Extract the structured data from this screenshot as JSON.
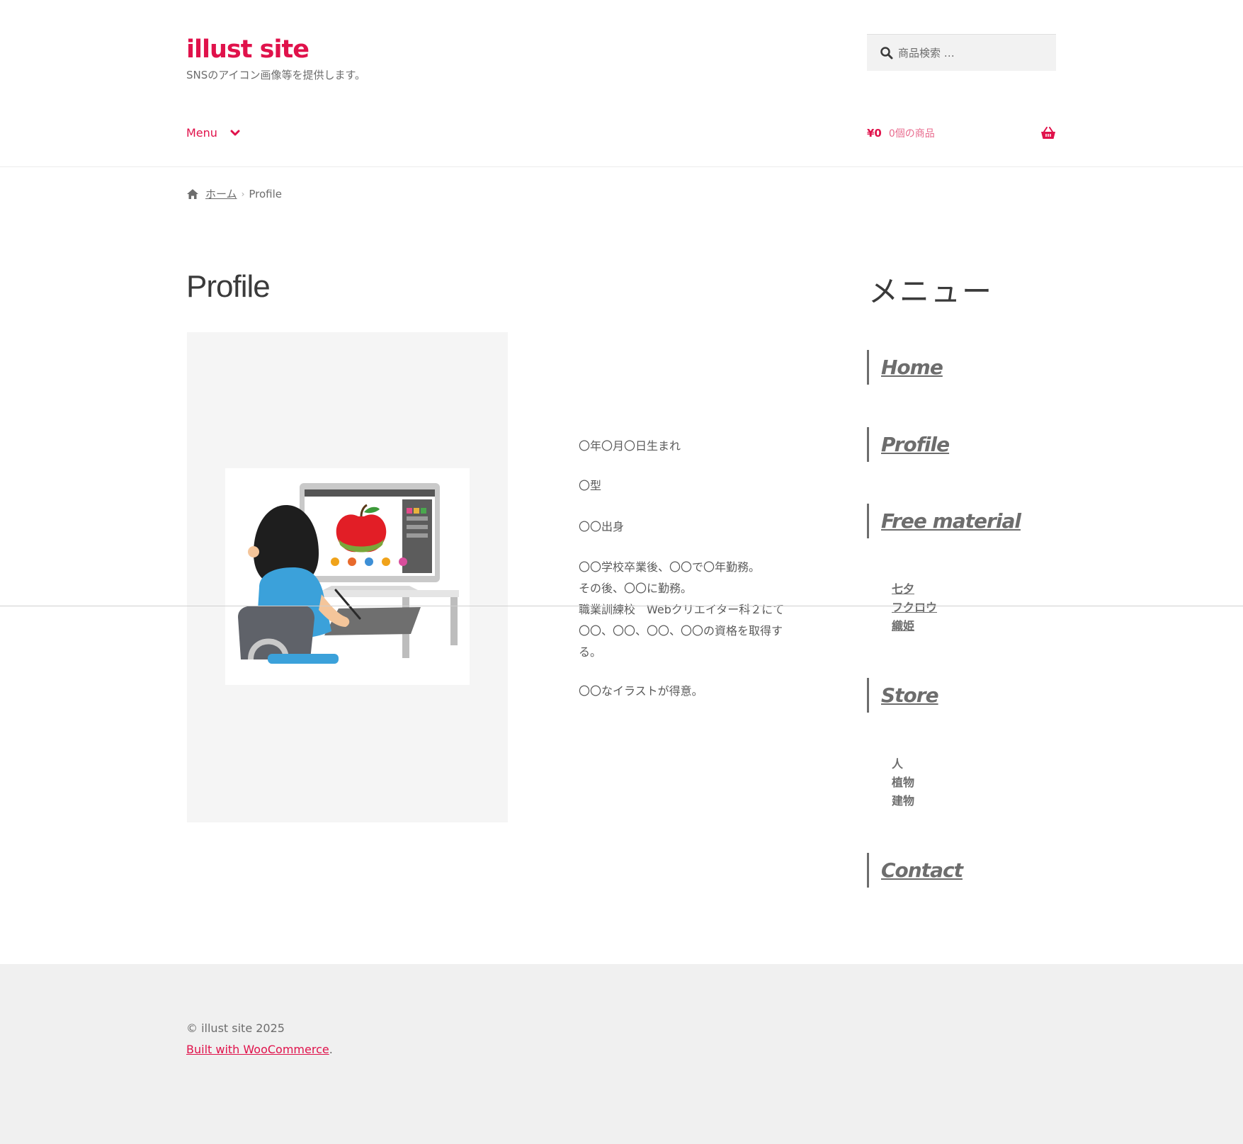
{
  "header": {
    "site_title": "illust site",
    "site_description": "SNSのアイコン画像等を提供します。",
    "search_placeholder": "商品検索 …",
    "menu_label": "Menu",
    "cart_amount": "¥0",
    "cart_count": "0個の商品"
  },
  "breadcrumb": {
    "home": "ホーム",
    "current": "Profile"
  },
  "main": {
    "title": "Profile",
    "bio": [
      "〇年〇月〇日生まれ",
      "〇型",
      "〇〇出身",
      "〇〇学校卒業後、〇〇で〇年勤務。",
      "その後、〇〇に勤務。",
      "職業訓練校　Webクリエイター科２にて",
      "〇〇、〇〇、〇〇、〇〇の資格を取得す",
      "る。",
      "〇〇なイラストが得意。"
    ]
  },
  "sidebar": {
    "title": "メニュー",
    "items": [
      "Home",
      "Profile",
      "Free material",
      "Store",
      "Contact"
    ],
    "free_material_sub": [
      "七夕",
      "フクロウ",
      "織姫"
    ],
    "store_sub": [
      "人",
      "植物",
      "建物"
    ]
  },
  "footer": {
    "copyright": "© illust site 2025",
    "built_link": "Built with WooCommerce",
    "built_suffix": "."
  },
  "icons": {
    "search": "search-icon",
    "menu_chevron": "chevron-down-icon",
    "cart": "basket-icon",
    "breadcrumb_home": "home-icon"
  },
  "colors": {
    "accent": "#e0124b",
    "text": "#6d6d6d",
    "footer_bg": "#f0f0f0"
  }
}
